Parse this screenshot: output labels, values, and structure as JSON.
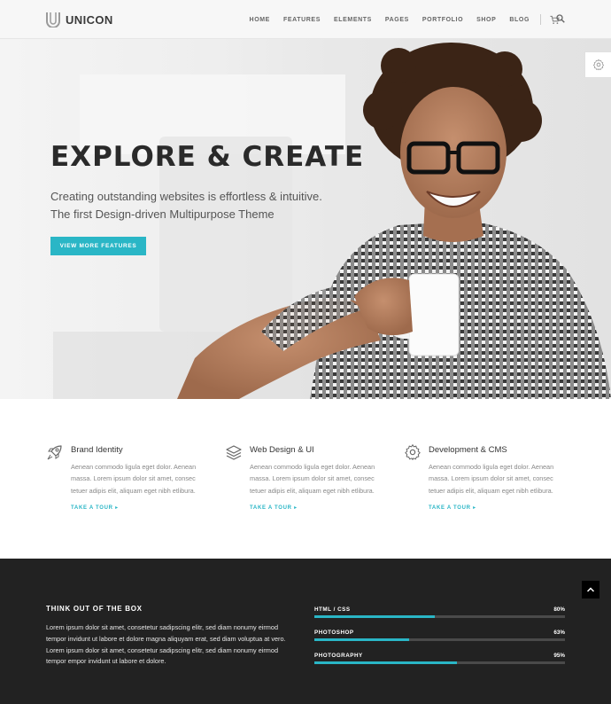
{
  "brand": {
    "name": "UNICON"
  },
  "nav": {
    "items": [
      "HOME",
      "FEATURES",
      "ELEMENTS",
      "PAGES",
      "PORTFOLIO",
      "SHOP",
      "BLOG"
    ],
    "icons": [
      "cart-icon",
      "search-icon"
    ]
  },
  "hero": {
    "title": "EXPLORE & CREATE",
    "subtitle_line1": "Creating outstanding websites is effortless & intuitive.",
    "subtitle_line2": "The first Design-driven Multipurpose Theme",
    "button": "VIEW MORE FEATURES",
    "accent": "#2ab6c6"
  },
  "features": [
    {
      "icon": "rocket-icon",
      "title": "Brand Identity",
      "text": "Aenean commodo ligula eget dolor. Aenean massa. Lorem ipsum dolor sit amet, consec tetuer adipis elit, aliquam eget nibh etlibura.",
      "link": "TAKE A TOUR"
    },
    {
      "icon": "layers-icon",
      "title": "Web Design & UI",
      "text": "Aenean commodo ligula eget dolor. Aenean massa. Lorem ipsum dolor sit amet, consec tetuer adipis elit, aliquam eget nibh etlibura.",
      "link": "TAKE A TOUR"
    },
    {
      "icon": "gear-icon",
      "title": "Development & CMS",
      "text": "Aenean commodo ligula eget dolor. Aenean massa. Lorem ipsum dolor sit amet, consec tetuer adipis elit, aliquam eget nibh etlibura.",
      "link": "TAKE A TOUR"
    }
  ],
  "about": {
    "title": "THINK OUT OF THE BOX",
    "text": "Lorem ipsum dolor sit amet, consetetur sadipscing elitr, sed diam nonumy eirmod tempor invidunt ut labore et dolore magna aliquyam erat, sed diam voluptua at vero. Lorem ipsum dolor sit amet, consetetur sadipscing elitr, sed diam nonumy eirmod tempor empor invidunt ut labore et dolore."
  },
  "skills": [
    {
      "name": "HTML / CSS",
      "percent_label": "80%",
      "percent": 80
    },
    {
      "name": "PHOTOSHOP",
      "percent_label": "63%",
      "percent": 63
    },
    {
      "name": "PHOTOGRAPHY",
      "percent_label": "95%",
      "percent": 95
    }
  ]
}
